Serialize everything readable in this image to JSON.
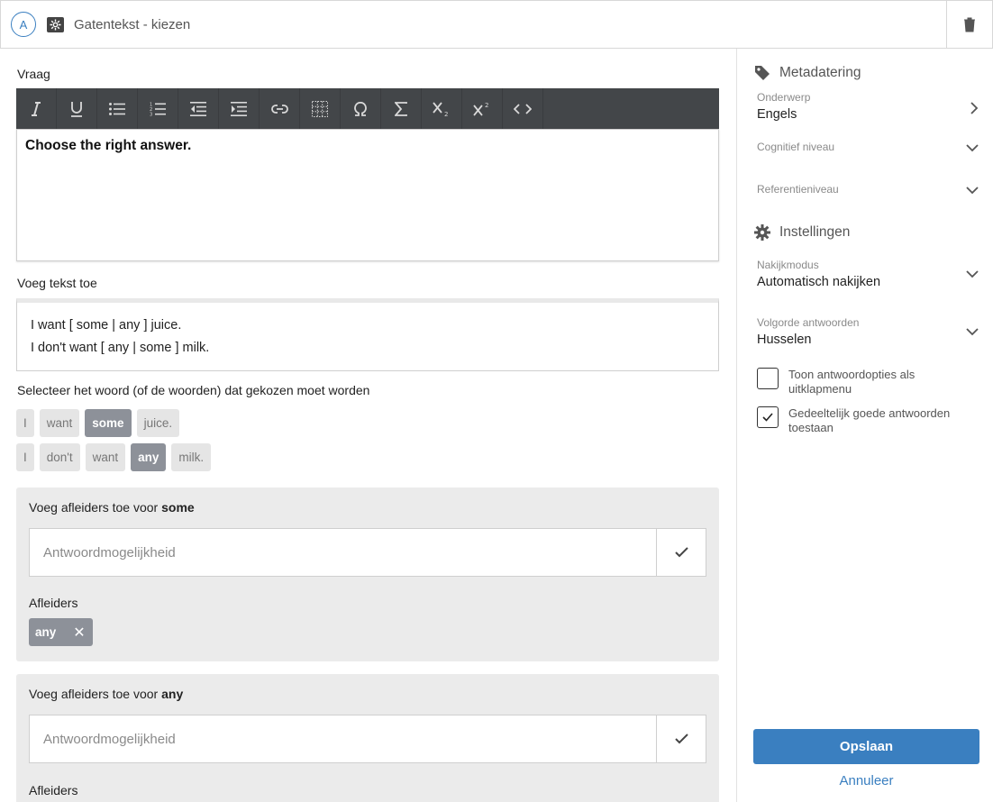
{
  "header": {
    "avatar_letter": "A",
    "title": "Gatentekst - kiezen",
    "type_icon": "cloze-question-icon",
    "delete_icon": "trash-icon"
  },
  "question": {
    "label": "Vraag",
    "toolbar": [
      {
        "name": "italic-icon",
        "glyph": "I"
      },
      {
        "name": "underline-icon",
        "glyph": "U"
      },
      {
        "name": "bullet-list-icon",
        "glyph": "☰"
      },
      {
        "name": "numbered-list-icon",
        "glyph": "☰"
      },
      {
        "name": "outdent-icon",
        "glyph": "⇤"
      },
      {
        "name": "indent-icon",
        "glyph": "⇥"
      },
      {
        "name": "link-icon",
        "glyph": "🔗"
      },
      {
        "name": "table-icon",
        "glyph": "▦"
      },
      {
        "name": "special-char-icon",
        "glyph": "Ω"
      },
      {
        "name": "formula-icon",
        "glyph": "Σ"
      },
      {
        "name": "subscript-icon",
        "glyph": "X₂"
      },
      {
        "name": "superscript-icon",
        "glyph": "X²"
      },
      {
        "name": "source-code-icon",
        "glyph": "<>"
      }
    ],
    "content": "Choose the right answer."
  },
  "text": {
    "label": "Voeg tekst toe",
    "lines": [
      "I want [ some | any ] juice.",
      "I don't want [ any | some ] milk."
    ]
  },
  "select": {
    "label": "Selecteer het woord (of de woorden) dat gekozen moet worden",
    "rows": [
      [
        {
          "text": "I",
          "selected": false
        },
        {
          "text": "want",
          "selected": false
        },
        {
          "text": "some",
          "selected": true
        },
        {
          "text": "juice.",
          "selected": false
        }
      ],
      [
        {
          "text": "I",
          "selected": false
        },
        {
          "text": "don't",
          "selected": false
        },
        {
          "text": "want",
          "selected": false
        },
        {
          "text": "any",
          "selected": true
        },
        {
          "text": "milk.",
          "selected": false
        }
      ]
    ]
  },
  "distractors": [
    {
      "title_prefix": "Voeg afleiders toe voor ",
      "word": "some",
      "placeholder": "Antwoordmogelijkheid",
      "afleiders_label": "Afleiders",
      "chips": [
        "any"
      ]
    },
    {
      "title_prefix": "Voeg afleiders toe voor ",
      "word": "any",
      "placeholder": "Antwoordmogelijkheid",
      "afleiders_label": "Afleiders",
      "chips": []
    }
  ],
  "sidebar": {
    "metadata_title": "Metadatering",
    "subject_label": "Onderwerp",
    "subject_value": "Engels",
    "cognitive_label": "Cognitief niveau",
    "reference_label": "Referentieniveau",
    "settings_title": "Instellingen",
    "grading_label": "Nakijkmodus",
    "grading_value": "Automatisch nakijken",
    "order_label": "Volgorde antwoorden",
    "order_value": "Husselen",
    "dropdown_option": {
      "label": "Toon antwoordopties als uitklapmenu",
      "checked": false
    },
    "partial_option": {
      "label": "Gedeeltelijk goede antwoorden toestaan",
      "checked": true
    },
    "save_label": "Opslaan",
    "cancel_label": "Annuleer"
  },
  "colors": {
    "accent": "#3a7fc0",
    "toolbar": "#434649",
    "selected_word": "#8d9199",
    "panel": "#ebebeb"
  }
}
